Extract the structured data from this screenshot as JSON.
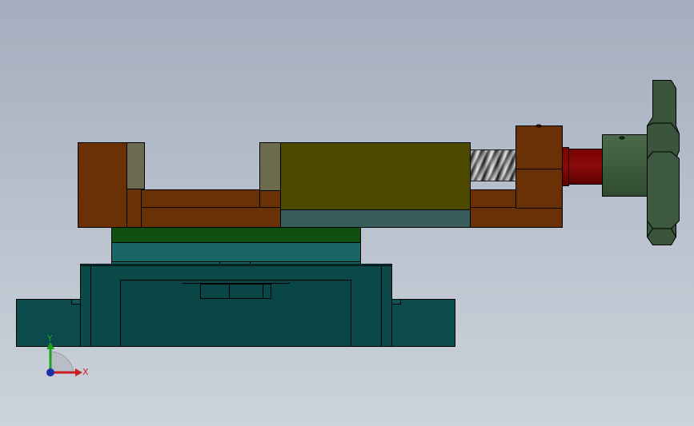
{
  "viewport": {
    "background_top": "#a3adbd",
    "background_bottom": "#cdd3db"
  },
  "model": {
    "parts": [
      {
        "name": "base-plate",
        "color": "#0b4b4b"
      },
      {
        "name": "swivel-housing",
        "color": "#0c4a4a"
      },
      {
        "name": "swivel-plate",
        "color": "#1a6565"
      },
      {
        "name": "green-layer",
        "color": "#0f4f0f"
      },
      {
        "name": "vise-body",
        "color": "#6b3106"
      },
      {
        "name": "jaw-plates",
        "color": "#6c6a4f"
      },
      {
        "name": "moving-jaw",
        "color": "#4d4a00"
      },
      {
        "name": "jaw-bottom-plate",
        "color": "#365c5c"
      },
      {
        "name": "lead-screw",
        "color": "#8c8c8c"
      },
      {
        "name": "end-block",
        "color": "#6b3106"
      },
      {
        "name": "collar",
        "color": "#720000"
      },
      {
        "name": "hub",
        "color": "#3f5f3f"
      },
      {
        "name": "handwheel",
        "color": "#3a553c"
      }
    ]
  },
  "triad": {
    "x_label": "X",
    "y_label": "Y",
    "x_color": "#c82020",
    "y_color": "#20a020",
    "z_color": "#1c2fa8"
  }
}
